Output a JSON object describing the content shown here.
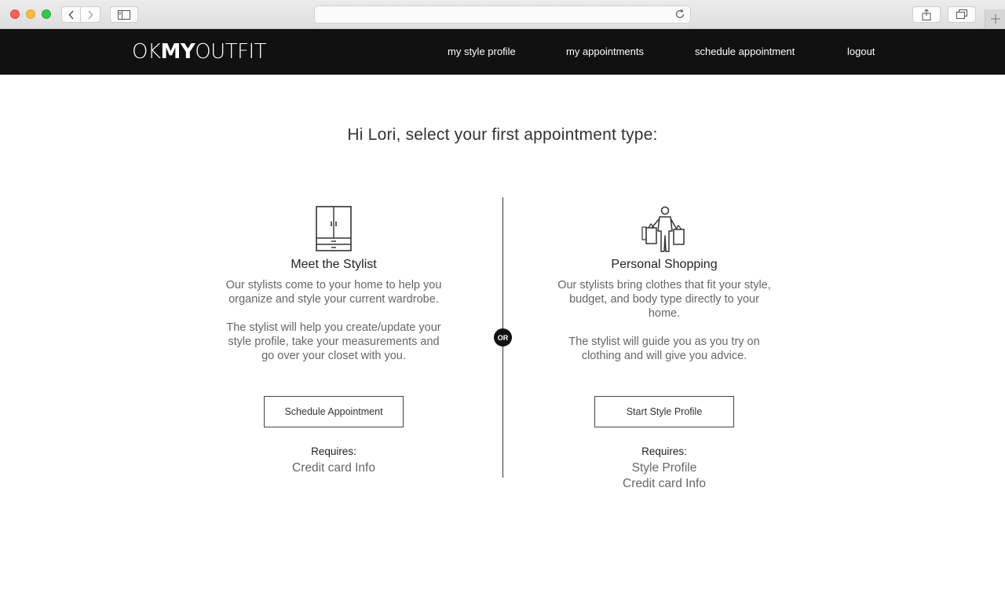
{
  "browser": {
    "address_text": "",
    "icons": {
      "back": "chevron-left-icon",
      "forward": "chevron-right-icon",
      "sidebar": "sidebar-icon",
      "reload": "reload-icon",
      "share": "share-icon",
      "tabs": "tabs-icon",
      "new_tab": "plus-icon"
    }
  },
  "header": {
    "logo_light_1": "OK",
    "logo_bold": "MY",
    "logo_light_2": "OUTFIT",
    "nav": [
      {
        "label": "my style profile"
      },
      {
        "label": "my appointments"
      },
      {
        "label": "schedule appointment"
      },
      {
        "label": "logout"
      }
    ]
  },
  "main": {
    "headline": "Hi Lori, select your first appointment type:",
    "or_label": "OR",
    "options": [
      {
        "icon": "wardrobe-icon",
        "title": "Meet the Stylist",
        "desc1": "Our stylists come to your home to help you organize and style your current wardrobe.",
        "desc2": "The stylist will help you create/update your style profile, take your measurements and go over your closet with you.",
        "button": "Schedule Appointment",
        "requires_label": "Requires:",
        "requires": [
          "Credit card Info"
        ]
      },
      {
        "icon": "shopping-person-icon",
        "title": "Personal Shopping",
        "desc1": "Our stylists bring clothes that fit your style, budget, and body type directly to your home.",
        "desc2": "The stylist will guide you as you try on clothing and will give you advice.",
        "button": "Start Style Profile",
        "requires_label": "Requires:",
        "requires": [
          "Style Profile",
          "Credit card Info"
        ]
      }
    ]
  },
  "colors": {
    "header_bg": "#111111",
    "text_dark": "#333333",
    "text_muted": "#666666"
  }
}
